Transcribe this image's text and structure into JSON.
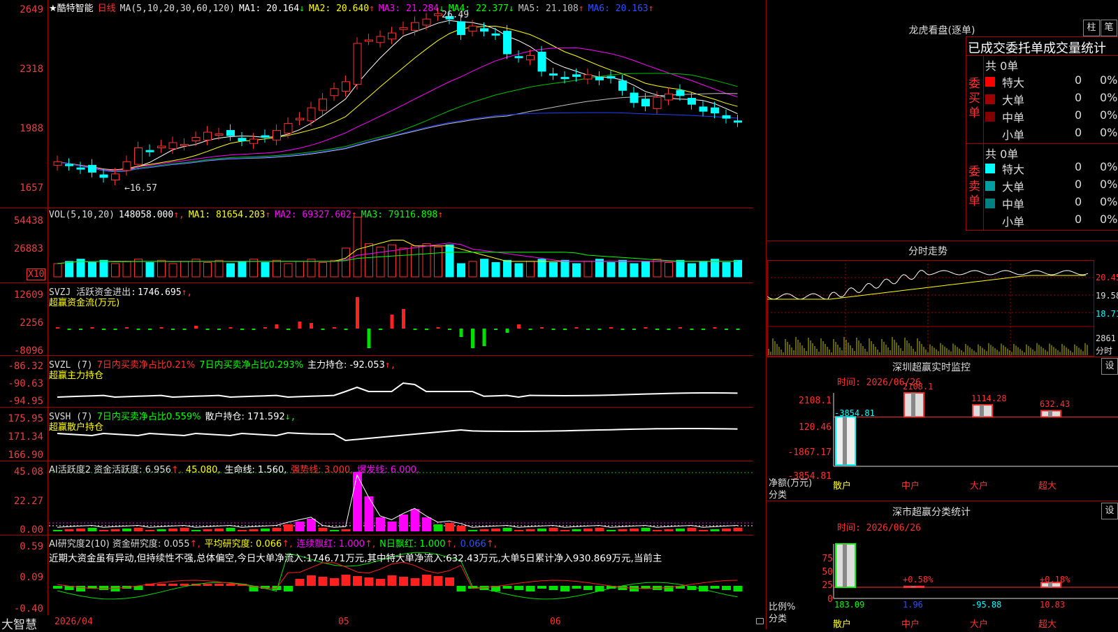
{
  "main": {
    "name": "★酷特智能",
    "period": "日线",
    "ma_params": "MA(5,10,20,30,60,120)",
    "ma": [
      {
        "label": "MA1:",
        "value": "20.164",
        "arrow": "↓",
        "color": "#ffffff"
      },
      {
        "label": "MA2:",
        "value": "20.640",
        "arrow": "↑",
        "color": "#ffff00"
      },
      {
        "label": "MA3:",
        "value": "21.284",
        "arrow": "↓",
        "color": "#ff00ff"
      },
      {
        "label": "MA4:",
        "value": "22.377",
        "arrow": "↓",
        "color": "#00ff00"
      },
      {
        "label": "MA5:",
        "value": "21.108",
        "arrow": "↑",
        "color": "#c0c0c0"
      },
      {
        "label": "MA6:",
        "value": "20.163",
        "arrow": "↑",
        "color": "#3050ff"
      }
    ],
    "y_labels": [
      "2649",
      "2318",
      "1988",
      "1657"
    ],
    "hi_label": "26.49",
    "lo_label": "←16.57"
  },
  "vol": {
    "params": "VOL(5,10,20)",
    "value": "148058.000",
    "ma": [
      {
        "label": "MA1:",
        "value": "81654.203",
        "arrow": "↑",
        "color": "#ffff00"
      },
      {
        "label": "MA2:",
        "value": "69327.602",
        "arrow": "↑",
        "color": "#ff00ff"
      },
      {
        "label": "MA3:",
        "value": "79116.898",
        "arrow": "↑",
        "color": "#00ff00"
      }
    ],
    "y_labels": [
      "54438",
      "26883"
    ],
    "unit": "X10"
  },
  "svzj": {
    "title": "SVZJ  活跃资金进出:",
    "value": "1746.695",
    "arrow": "↑,",
    "subtitle": "超赢资金流(万元)",
    "y_labels": [
      "12609",
      "2256",
      "-8096"
    ]
  },
  "svzl": {
    "title": "SVZL (7)",
    "t1": "7日内买卖净占比0.21%",
    "t2": "7日内买卖净占比0.293%",
    "t3": "主力持仓: -92.053",
    "t3_arrow": "↑,",
    "subtitle": "超赢主力持仓",
    "y_labels": [
      "-86.32",
      "-90.63",
      "-94.95"
    ]
  },
  "svsh": {
    "title": "SVSH (7)",
    "t1": "7日内买卖净占比0.559%",
    "t2": "散户持仓: 171.592",
    "t2_arrow": "↓,",
    "subtitle": "超赢散户持仓",
    "y_labels": [
      "175.95",
      "171.34",
      "166.90"
    ]
  },
  "ai_act": {
    "title": "AI活跃度2 资金活跃度: 6.956",
    "a1": "↑,",
    "t2": "45.080,",
    "t3": "生命线: 1.560,",
    "t4": "强势线: 3.000,",
    "t5": "爆发线: 6.000,",
    "y_labels": [
      "45.08",
      "22.27",
      "0.00"
    ]
  },
  "ai_res": {
    "title": "AI研究度2(10) 资金研究度: 0.055",
    "a1": "↑,",
    "t2": "平均研究度: 0.066",
    "a2": "↑,",
    "t3": "连续飘红: 1.000",
    "a3": "↑,",
    "t4": "N日飘红: 1.000",
    "a4": "↑,",
    "t5": "0.066",
    "a5": "↑,",
    "summary": "近期大资金虽有异动,但持续性不强,总体偏空,今日大单净流入:1746.71万元,其中特大单净流入:632.43万元,大单5日累计净入930.869万元,当前主",
    "y_labels": [
      "0.59",
      "0.09",
      "-0.40"
    ]
  },
  "xaxis": {
    "d1": "2026/04",
    "d2": "05",
    "d3": "06"
  },
  "logo": "大智慧",
  "right": {
    "lhb_title": "龙虎看盘(逐单)",
    "btn1": "柱",
    "btn2": "笔",
    "stat_title": "已成交委托单成交量统计",
    "buy_total": "共 0单",
    "sell_total": "共 0单",
    "buy_side": "委买单",
    "sell_side": "委卖单",
    "buy_rows": [
      {
        "label": "特大",
        "count": "0",
        "pct": "0%",
        "color": "#ff0000"
      },
      {
        "label": "大单",
        "count": "0",
        "pct": "0%",
        "color": "#a00000"
      },
      {
        "label": "中单",
        "count": "0",
        "pct": "0%",
        "color": "#800000"
      },
      {
        "label": "小单",
        "count": "0",
        "pct": "0%",
        "color": ""
      }
    ],
    "sell_rows": [
      {
        "label": "特大",
        "count": "0",
        "pct": "0%",
        "color": "#00ffff"
      },
      {
        "label": "大单",
        "count": "0",
        "pct": "0%",
        "color": "#00a0a0"
      },
      {
        "label": "中单",
        "count": "0",
        "pct": "0%",
        "color": "#008080"
      },
      {
        "label": "小单",
        "count": "0",
        "pct": "0%",
        "color": ""
      }
    ],
    "fs_title": "分时走势",
    "fs_y": [
      "20.45",
      "19.58",
      "18.71"
    ],
    "fs_vol": "2861",
    "fs_unit": "分时",
    "sz_title": "深圳超赢实时监控",
    "sz_btn": "设",
    "sz_time": "时间: 2026/06/26",
    "sz_y": [
      "2108.1",
      "120.46",
      "-1867.17",
      "-3854.81"
    ],
    "sz_unit": "净额(万元)",
    "sz_cat": "分类",
    "sz_bars": [
      {
        "name": "散户",
        "value": "-3854.81"
      },
      {
        "name": "中户",
        "value": "2108.1"
      },
      {
        "name": "大户",
        "value": "1114.28"
      },
      {
        "name": "超大",
        "value": "632.43"
      }
    ],
    "ss_title": "深市超赢分类统计",
    "ss_btn": "设",
    "ss_time": "时间: 2026/06/26",
    "ss_y": [
      "75",
      "50",
      "25",
      "0"
    ],
    "ss_unit": "比例%",
    "ss_cat": "分类",
    "ss_bars": [
      {
        "name": "散户",
        "value": "183.09",
        "pct": ""
      },
      {
        "name": "中户",
        "value": "1.96",
        "pct": "+0.58%"
      },
      {
        "name": "大户",
        "value": "-95.88",
        "pct": ""
      },
      {
        "name": "超大",
        "value": "10.83",
        "pct": "+0.18%"
      }
    ]
  },
  "chart_data": [
    {
      "type": "candlestick",
      "title": "日线",
      "ylim": [
        16.57,
        26.49
      ],
      "series": [
        {
          "name": "MA1",
          "values": [
            20.164
          ]
        },
        {
          "name": "MA2",
          "values": [
            20.64
          ]
        },
        {
          "name": "MA3",
          "values": [
            21.284
          ]
        },
        {
          "name": "MA4",
          "values": [
            22.377
          ]
        },
        {
          "name": "MA5",
          "values": [
            21.108
          ]
        },
        {
          "name": "MA6",
          "values": [
            20.163
          ]
        }
      ],
      "high": 26.49,
      "low": 16.57
    },
    {
      "type": "bar",
      "title": "VOL(5,10,20)",
      "series": [
        {
          "name": "VOL",
          "values": [
            148058.0
          ]
        },
        {
          "name": "MA1",
          "values": [
            81654.203
          ]
        },
        {
          "name": "MA2",
          "values": [
            69327.602
          ]
        },
        {
          "name": "MA3",
          "values": [
            79116.898
          ]
        }
      ]
    },
    {
      "type": "bar",
      "title": "深圳超赢实时监控",
      "categories": [
        "散户",
        "中户",
        "大户",
        "超大"
      ],
      "values": [
        -3854.81,
        2108.1,
        1114.28,
        632.43
      ],
      "ylabel": "净额(万元)",
      "ylim": [
        -3854.81,
        2108.1
      ]
    },
    {
      "type": "bar",
      "title": "深市超赢分类统计",
      "categories": [
        "散户",
        "中户",
        "大户",
        "超大"
      ],
      "values": [
        183.09,
        1.96,
        -95.88,
        10.83
      ],
      "ylabel": "比例%",
      "ylim": [
        0,
        75
      ]
    }
  ]
}
